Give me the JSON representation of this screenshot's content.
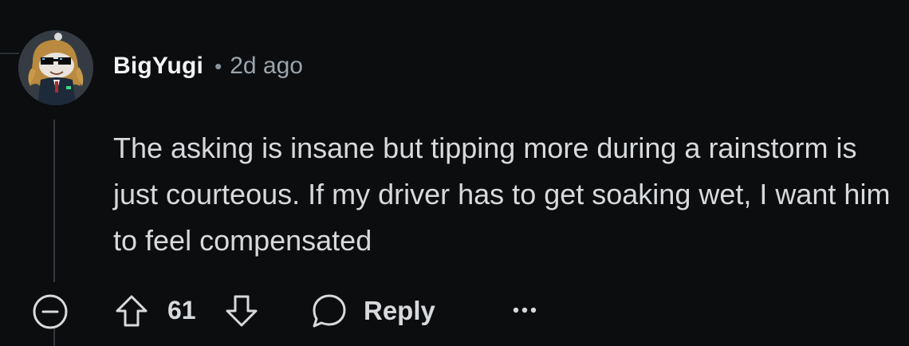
{
  "comment": {
    "author": "BigYugi",
    "separator": "•",
    "timestamp": "2d ago",
    "body": "The asking is insane but tipping more during a rainstorm is just courteous. If my driver has to get soaking wet, I want him to feel compensated",
    "score": "61",
    "reply_label": "Reply"
  },
  "colors": {
    "background": "#0b0d0f",
    "text_primary": "#d7dadc",
    "text_muted": "#9aa4ac",
    "username": "#f2f3f5",
    "avatar_bg": "#343b43"
  },
  "icons": {
    "collapse": "minus-circle-icon",
    "upvote": "arrow-up-icon",
    "downvote": "arrow-down-icon",
    "reply": "speech-bubble-icon",
    "more": "ellipsis-icon",
    "avatar": "snoo-avatar-sunglasses"
  }
}
